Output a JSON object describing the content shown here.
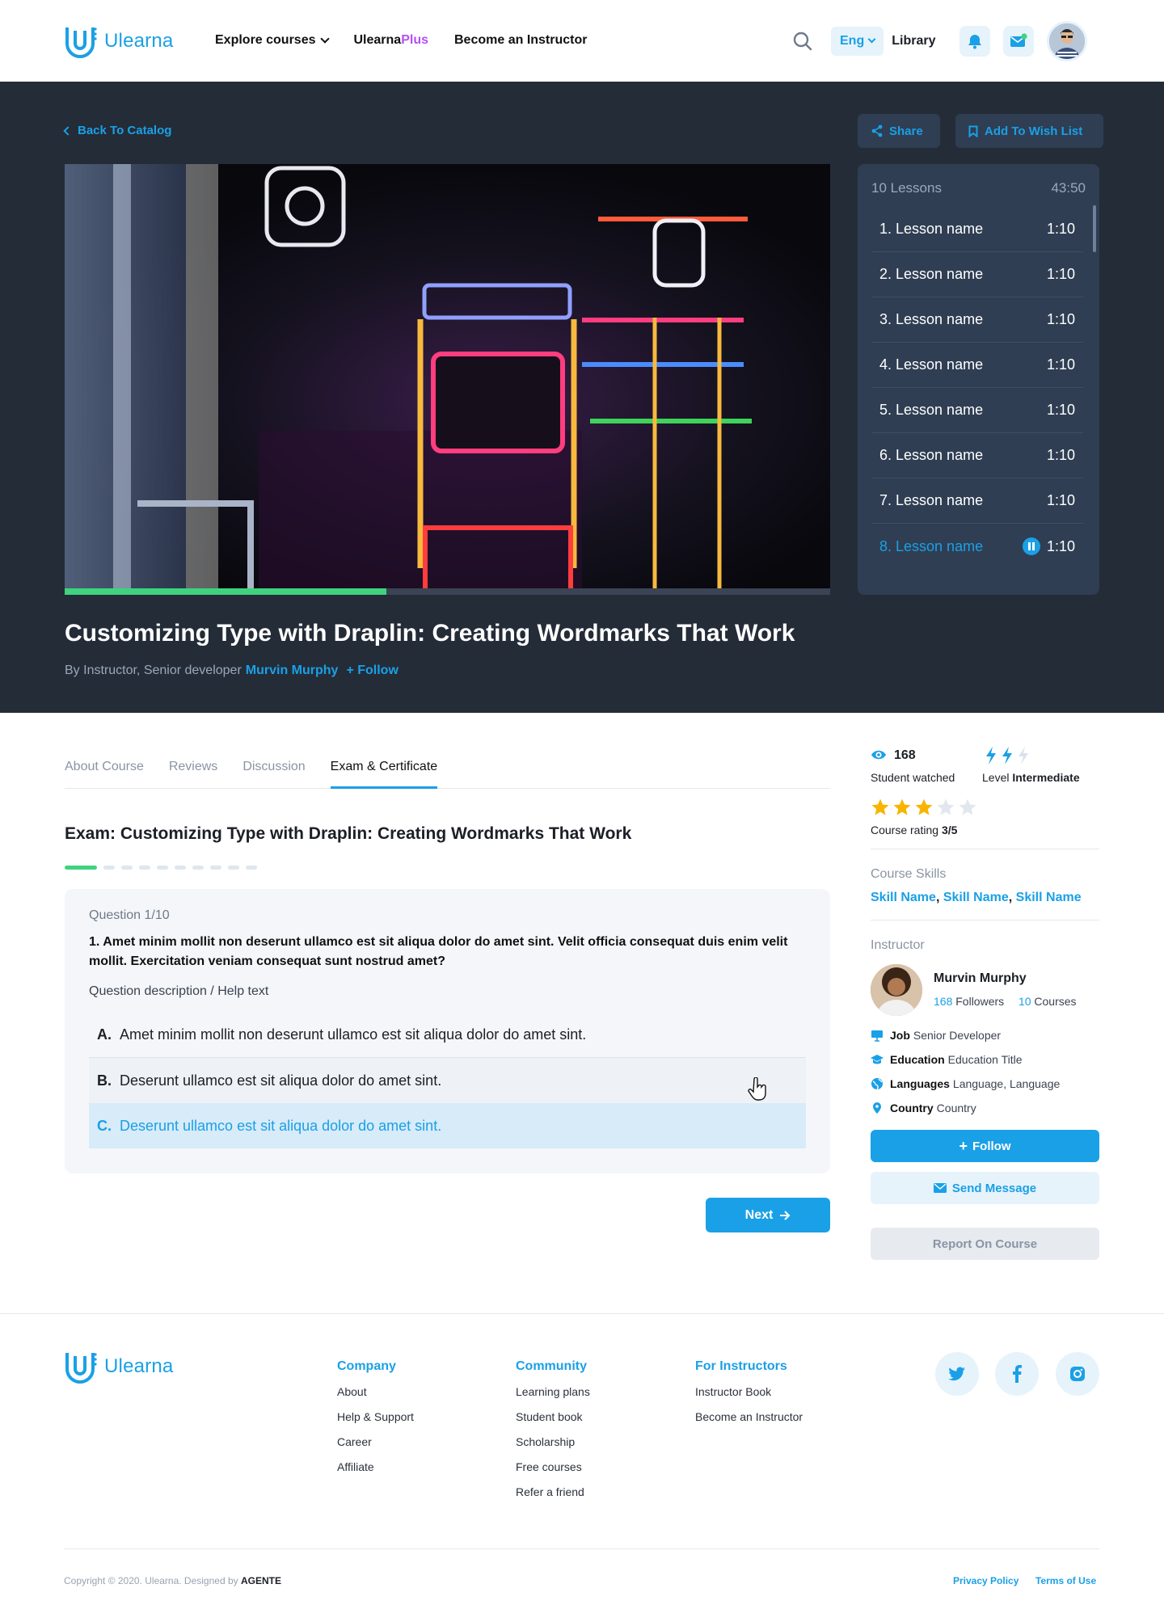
{
  "brand": {
    "name": "Ulearna",
    "accent": "#1aa0e6",
    "plus_color": "#b44ff5"
  },
  "nav": {
    "explore": "Explore courses",
    "plus_prefix": "Ulearna",
    "plus_suffix": "Plus",
    "instructor": "Become an Instructor",
    "lang": "Eng",
    "library": "Library"
  },
  "hero": {
    "back": "Back To Catalog",
    "share": "Share",
    "wishlist": "Add To Wish List",
    "video_progress": 0.42,
    "title": "Customizing Type with Draplin: Creating Wordmarks That Work",
    "by": "By Instructor, Senior developer",
    "instructor": "Murvin Murphy",
    "follow": "+ Follow"
  },
  "lessons": {
    "count": "10 Lessons",
    "total": "43:50",
    "items": [
      {
        "label": "1. Lesson name",
        "dur": "1:10"
      },
      {
        "label": "2. Lesson name",
        "dur": "1:10"
      },
      {
        "label": "3. Lesson name",
        "dur": "1:10"
      },
      {
        "label": "4. Lesson name",
        "dur": "1:10"
      },
      {
        "label": "5. Lesson name",
        "dur": "1:10"
      },
      {
        "label": "6. Lesson name",
        "dur": "1:10"
      },
      {
        "label": "7. Lesson name",
        "dur": "1:10"
      },
      {
        "label": "8. Lesson name",
        "dur": "1:10"
      }
    ]
  },
  "tabs": [
    "About Course",
    "Reviews",
    "Discussion",
    "Exam & Certificate"
  ],
  "exam": {
    "title": "Exam: Customizing Type with Draplin: Creating Wordmarks That Work",
    "question_num": "Question 1/10",
    "question": "1. Amet minim mollit non deserunt ullamco est sit aliqua dolor do amet sint. Velit officia consequat duis enim velit mollit. Exercitation veniam consequat sunt nostrud amet?",
    "help": "Question description / Help text",
    "options": [
      {
        "letter": "A.",
        "text": "Amet minim mollit non deserunt ullamco est sit aliqua dolor do amet sint."
      },
      {
        "letter": "B.",
        "text": "Deserunt ullamco est sit aliqua dolor do amet sint."
      },
      {
        "letter": "C.",
        "text": "Deserunt ullamco est sit aliqua dolor do amet sint."
      }
    ],
    "next": "Next"
  },
  "sidebar": {
    "watched_count": "168",
    "watched_label": "Student watched",
    "level_label": "Level",
    "level_value": "Intermediate",
    "level_bars": 2,
    "rating_stars": 3,
    "rating_label": "Course rating",
    "rating_value": "3/5",
    "skills_label": "Course Skills",
    "skills": [
      "Skill Name",
      "Skill Name",
      "Skill Name"
    ],
    "instructor_label": "Instructor",
    "instructor_name": "Murvin Murphy",
    "followers_count": "168",
    "followers_label": "Followers",
    "courses_count": "10",
    "courses_label": "Courses",
    "job_label": "Job",
    "job_value": "Senior Developer",
    "edu_label": "Education",
    "edu_value": "Education Title",
    "lang_label": "Languages",
    "lang_value": "Language, Language",
    "country_label": "Country",
    "country_value": "Country",
    "follow": "Follow",
    "message": "Send Message",
    "report": "Report On Course"
  },
  "footer": {
    "company_title": "Company",
    "company": [
      "About",
      "Help & Support",
      "Career",
      "Affiliate"
    ],
    "community_title": "Community",
    "community": [
      "Learning plans",
      "Student book",
      "Scholarship",
      "Free courses",
      "Refer a friend"
    ],
    "instructors_title": "For Instructors",
    "instructors": [
      "Instructor Book",
      "Become an Instructor"
    ],
    "copyright": "Copyright © 2020. Ulearna. Designed by",
    "designer": "AGENTE",
    "privacy": "Privacy Policy",
    "terms": "Terms of Use"
  },
  "icons": [
    "logo-icon",
    "search-icon",
    "bell-icon",
    "mail-icon",
    "share-icon",
    "bookmark-icon",
    "pause-icon",
    "eye-icon",
    "bolt-icon",
    "star-icon",
    "twitter-icon",
    "facebook-icon",
    "instagram-icon"
  ]
}
